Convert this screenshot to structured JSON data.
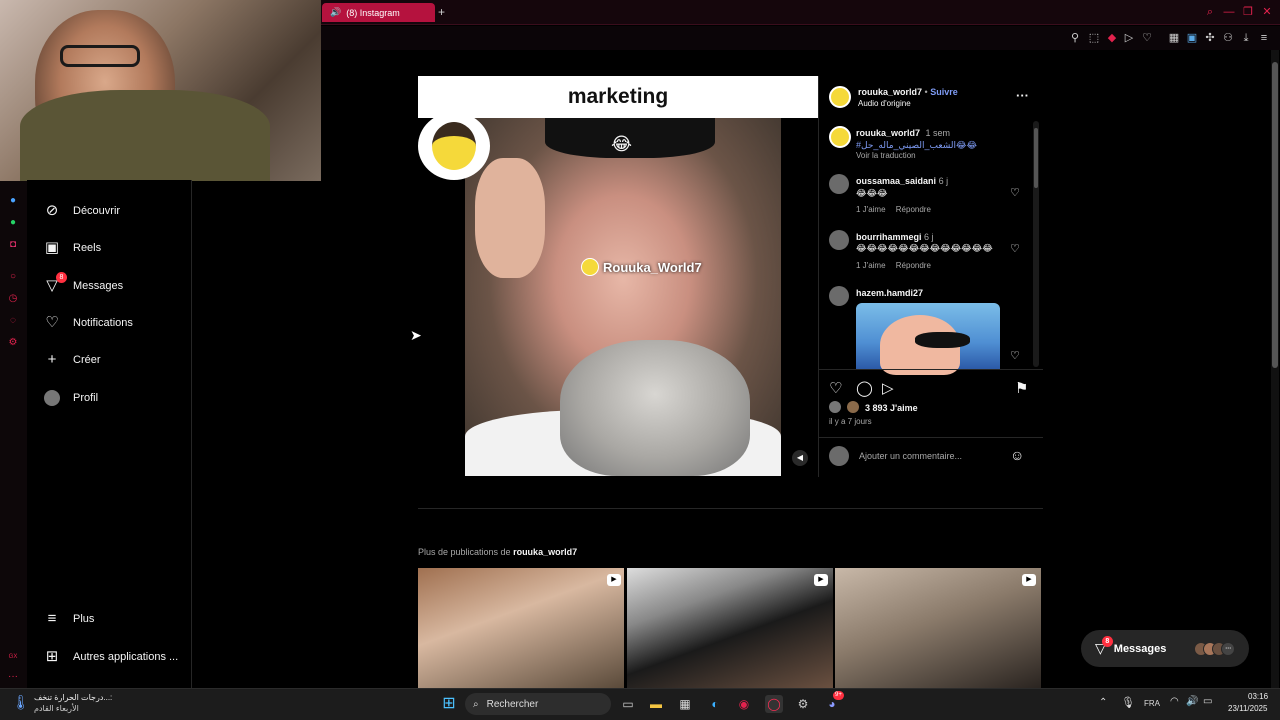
{
  "browser": {
    "tab_title": "(8) Instagram",
    "new_tab": "+",
    "window_controls": [
      "🔍",
      "—",
      "❐",
      "✕"
    ]
  },
  "nav": {
    "items": [
      {
        "label": "Découvrir",
        "icon": "compass-icon",
        "glyph": "🧭"
      },
      {
        "label": "Reels",
        "icon": "reels-icon",
        "glyph": "▶"
      },
      {
        "label": "Messages",
        "icon": "messenger-icon",
        "glyph": "✈",
        "badge": "8"
      },
      {
        "label": "Notifications",
        "icon": "heart-icon",
        "glyph": "♡"
      },
      {
        "label": "Créer",
        "icon": "plus-icon",
        "glyph": "+"
      },
      {
        "label": "Profil",
        "icon": "profile-avatar",
        "glyph": "◉"
      }
    ],
    "more_label": "Plus",
    "more_glyph": "≡",
    "apps_label": "Autres applications ...",
    "apps_glyph": "⁝⁝"
  },
  "post": {
    "banner": "marketing",
    "watermark": "Rouuka_World7",
    "emoji": "😂",
    "mute_glyph": "🔇",
    "username": "rouuka_world7",
    "dot": "•",
    "follow": "Suivre",
    "audio": "Audio d'origine",
    "options_glyph": "···",
    "caption_user": "rouuka_world7",
    "caption_time": "1 sem",
    "caption_text": "#الشعب_الصيني_ماله_حل😂😂",
    "see_translation": "Voir la traduction",
    "comments": [
      {
        "user": "oussamaa_saidani",
        "time": "6 j",
        "text": "😂😂😂",
        "likes": "1 J'aime",
        "reply": "Répondre"
      },
      {
        "user": "bourrihammegi",
        "time": "6 j",
        "text": "😂😂😂😂😂😂😂😂😂😂😂😂😂",
        "likes": "1 J'aime",
        "reply": "Répondre"
      },
      {
        "user": "hazem.hamdi27",
        "time": "",
        "text": "",
        "likes": "",
        "reply": ""
      }
    ],
    "likes": "3 893 J'aime",
    "posted": "il y a 7 jours",
    "comment_placeholder": "Ajouter un commentaire...",
    "emoji_glyph": "☺"
  },
  "more": {
    "prefix": "Plus de publications de ",
    "user": "rouuka_world7"
  },
  "messages_pill": {
    "label": "Messages",
    "badge": "8",
    "more_glyph": "···"
  },
  "taskbar": {
    "weather_line1": "درجات الحرارة تنخف...:",
    "weather_line2": "الأربعاء القادم",
    "search_label": "Rechercher",
    "lang": "FRA",
    "time": "03:16",
    "date": "23/11/2025",
    "discord_badge": "9+"
  }
}
